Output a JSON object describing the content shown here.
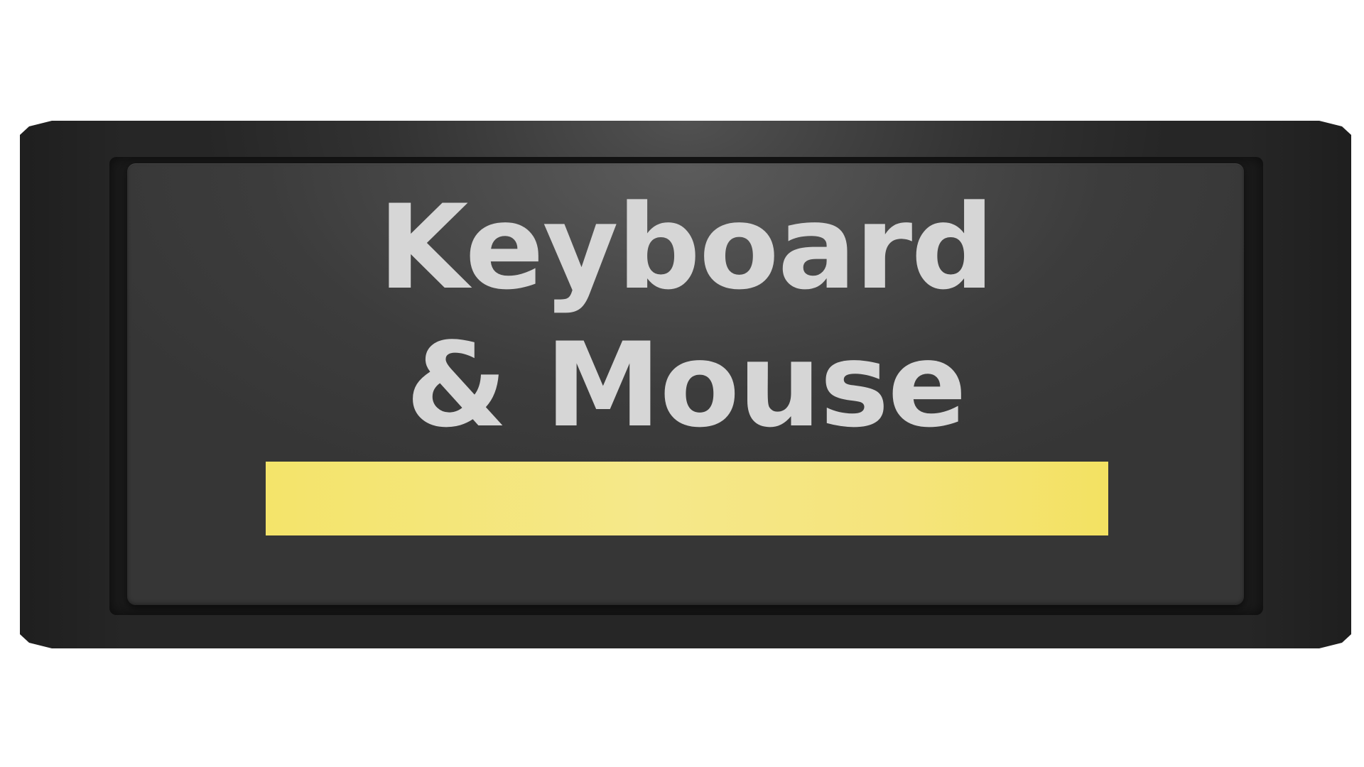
{
  "key": {
    "label_line1": "Keyboard",
    "label_line2": "& Mouse",
    "label_color": "#d6d6d6",
    "indicator_color": "#f4e46a",
    "plate_color": "#262626",
    "face_color": "#4a4a4a"
  }
}
